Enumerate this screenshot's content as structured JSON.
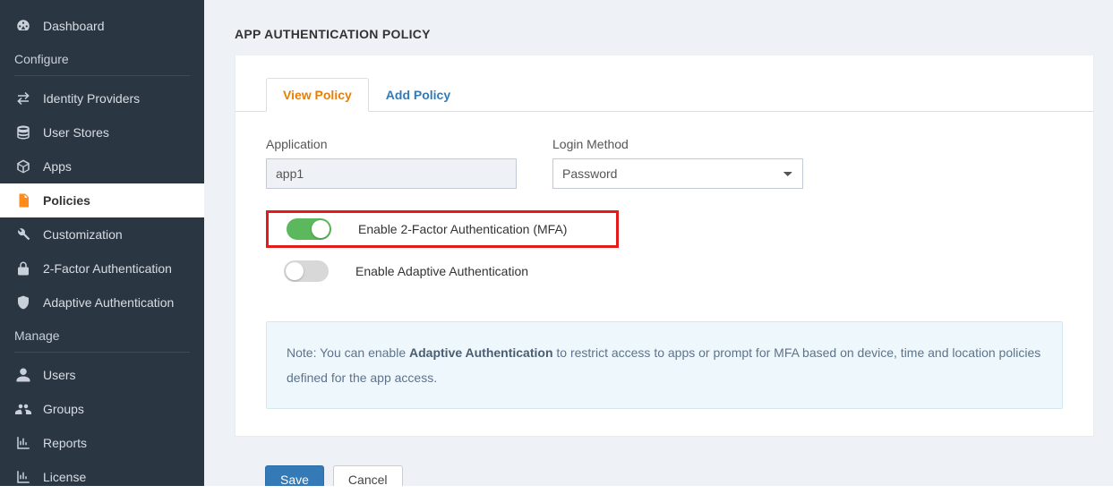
{
  "sidebar": {
    "dashboard": "Dashboard",
    "section_configure": "Configure",
    "items_configure": [
      {
        "label": "Identity Providers",
        "icon": "swap-icon"
      },
      {
        "label": "User Stores",
        "icon": "database-icon"
      },
      {
        "label": "Apps",
        "icon": "cube-icon"
      },
      {
        "label": "Policies",
        "icon": "document-icon",
        "active": true
      },
      {
        "label": "Customization",
        "icon": "wrench-icon"
      },
      {
        "label": "2-Factor Authentication",
        "icon": "lock-icon"
      },
      {
        "label": "Adaptive Authentication",
        "icon": "shield-icon"
      }
    ],
    "section_manage": "Manage",
    "items_manage": [
      {
        "label": "Users",
        "icon": "user-icon"
      },
      {
        "label": "Groups",
        "icon": "users-icon"
      },
      {
        "label": "Reports",
        "icon": "chart-icon"
      },
      {
        "label": "License",
        "icon": "chart-icon"
      }
    ]
  },
  "page": {
    "title": "APP AUTHENTICATION POLICY"
  },
  "tabs": {
    "view": "View Policy",
    "add": "Add Policy"
  },
  "form": {
    "application_label": "Application",
    "application_value": "app1",
    "login_method_label": "Login Method",
    "login_method_value": "Password",
    "mfa_label": "Enable 2-Factor Authentication (MFA)",
    "mfa_on": true,
    "adaptive_label": "Enable Adaptive Authentication",
    "adaptive_on": false
  },
  "note": {
    "prefix": "Note: You can enable ",
    "strong": "Adaptive Authentication",
    "suffix": " to restrict access to apps or prompt for MFA based on device, time and location policies defined for the app access."
  },
  "buttons": {
    "save": "Save",
    "cancel": "Cancel"
  }
}
